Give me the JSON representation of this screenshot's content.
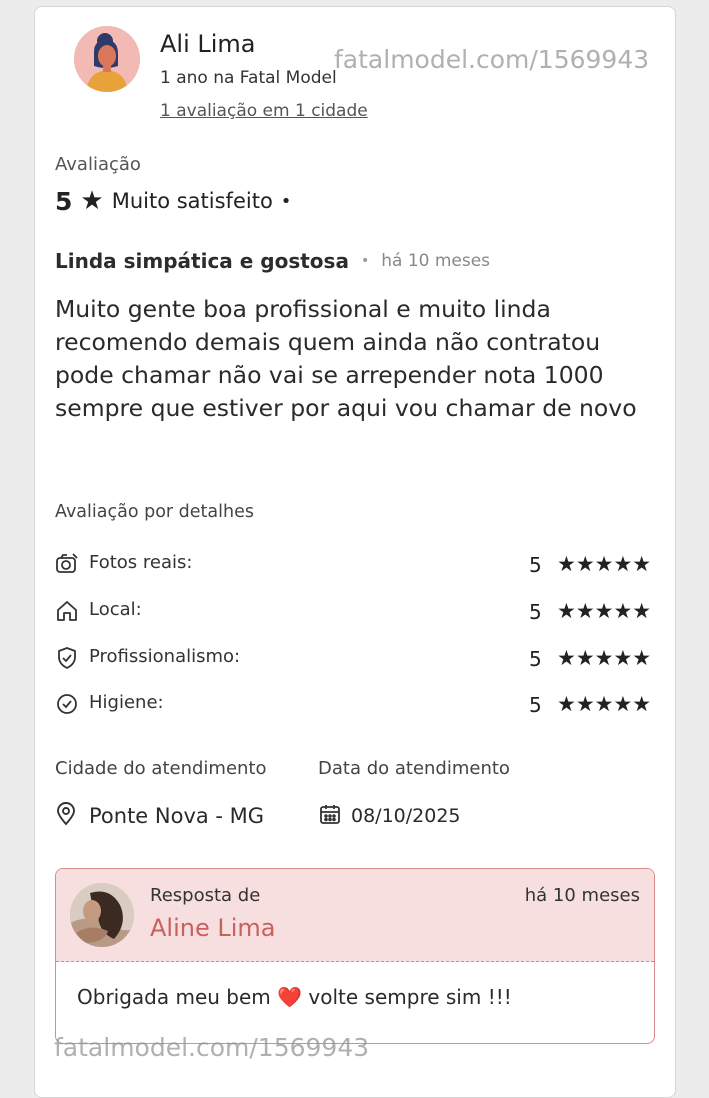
{
  "reviewer": {
    "name": "Ali Lima",
    "since": "1 ano na Fatal Model",
    "reviews_count": "1 avaliação em 1 cidade"
  },
  "watermark": {
    "top": "fatalmodel.com/1569943",
    "bottom": "fatalmodel.com/1569943"
  },
  "rating": {
    "label": "Avaliação",
    "value": "5",
    "star": "★",
    "text": "Muito satisfeito",
    "dot": "•"
  },
  "review": {
    "title": "Linda simpática e gostosa",
    "dot": "•",
    "time": "há 10 meses",
    "body": "Muito gente boa profissional e muito linda recomendo demais quem ainda não contratou pode chamar não vai se arrepender nota 1000 sempre que estiver por aqui vou chamar de novo"
  },
  "details": {
    "label": "Avaliação por detalhes",
    "items": [
      {
        "icon": "camera-icon",
        "label": "Fotos reais:",
        "score": "5",
        "stars": "★★★★★",
        "rating": 5
      },
      {
        "icon": "home-icon",
        "label": "Local:",
        "score": "5",
        "stars": "★★★★★",
        "rating": 5
      },
      {
        "icon": "shield-check-icon",
        "label": "Profissionalismo:",
        "score": "5",
        "stars": "★★★★★",
        "rating": 5
      },
      {
        "icon": "check-circle-icon",
        "label": "Higiene:",
        "score": "5",
        "stars": "★★★★★",
        "rating": 5
      }
    ]
  },
  "service": {
    "city_label": "Cidade do atendimento",
    "date_label": "Data do atendimento",
    "city": "Ponte Nova - MG",
    "date": "08/10/2025"
  },
  "reply": {
    "prefix": "Resposta de",
    "name": "Aline Lima",
    "time": "há 10 meses",
    "text_before": "Obrigada meu bem",
    "emoji": "❤️",
    "text_after": "volte sempre sim !!!"
  },
  "colors": {
    "reply_border": "#d98a8a",
    "reply_background": "#f7dfe0",
    "reply_name": "#c9605c",
    "heart": "#d73a3a"
  }
}
